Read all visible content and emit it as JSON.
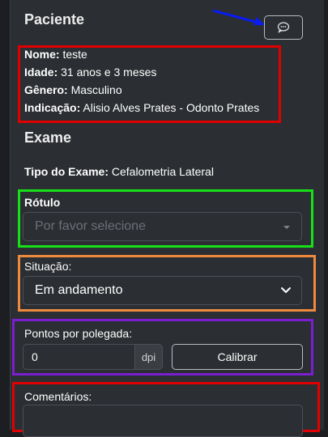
{
  "patient": {
    "title": "Paciente",
    "name_label": "Nome:",
    "name_value": "teste",
    "age_label": "Idade:",
    "age_value": "31 anos e 3 meses",
    "gender_label": "Gênero:",
    "gender_value": "Masculino",
    "indication_label": "Indicação:",
    "indication_value": "Alisio Alves Prates - Odonto Prates",
    "message_icon": "chat-bubble-icon"
  },
  "exam": {
    "title": "Exame",
    "type_label": "Tipo do Exame:",
    "type_value": "Cefalometria Lateral",
    "label_field": {
      "label": "Rótulo",
      "placeholder": "Por favor selecione"
    },
    "status_field": {
      "label": "Situação:",
      "selected": "Em andamento"
    },
    "dpi_field": {
      "label": "Pontos por polegada:",
      "value": "0",
      "unit": "dpi",
      "calibrate_label": "Calibrar"
    },
    "comments_field": {
      "label": "Comentários:"
    }
  },
  "colors": {
    "background": "#2b2e32",
    "annotation_red": "#e00000",
    "annotation_green": "#18e018",
    "annotation_orange": "#ee8a3e",
    "annotation_purple": "#7a1ed0",
    "annotation_blue": "#0a1cf0"
  }
}
